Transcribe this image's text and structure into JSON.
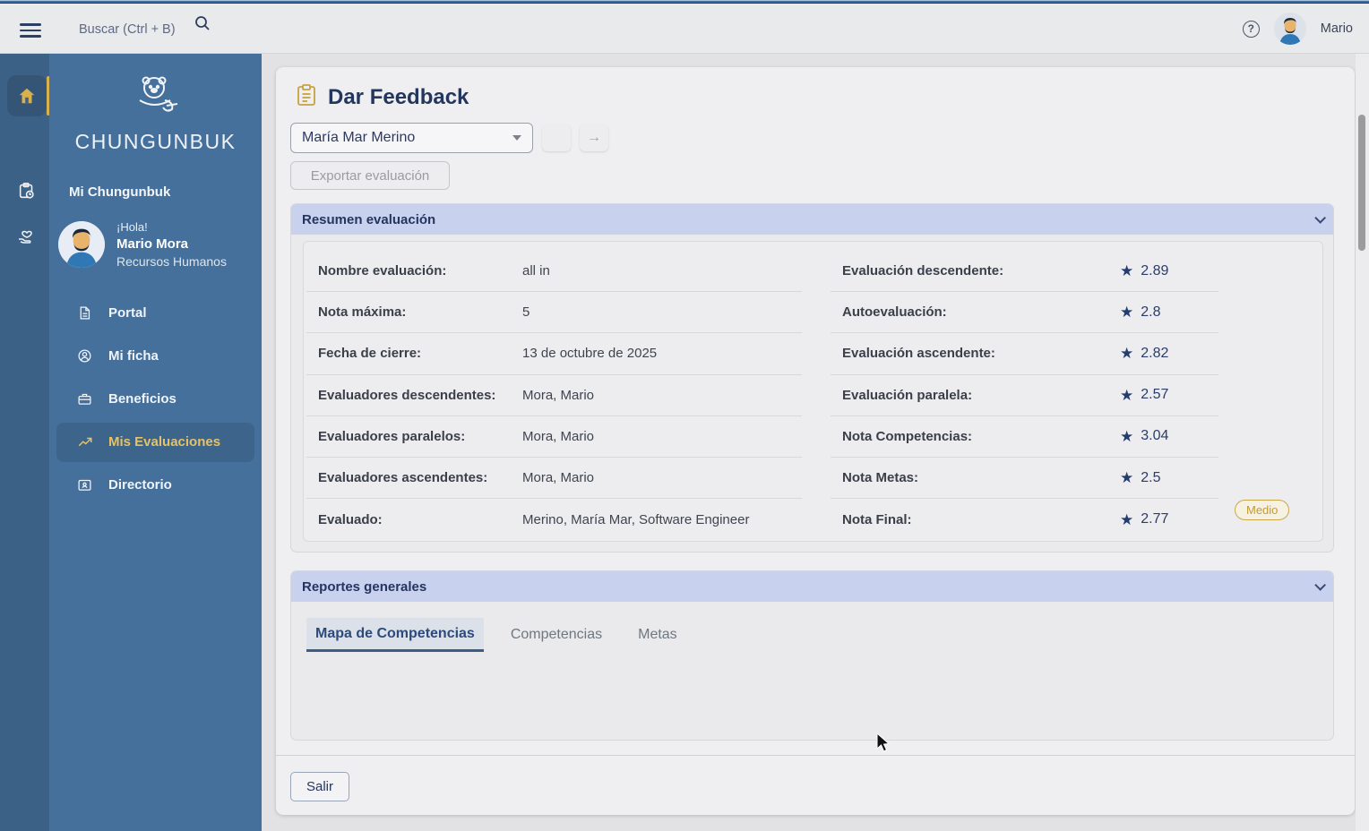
{
  "topbar": {
    "search_placeholder": "Buscar (Ctrl + B)",
    "user_name": "Mario"
  },
  "sidebar": {
    "logo_text": "CHUNGUNBUK",
    "section_label": "Mi Chungunbuk",
    "greeting": "¡Hola!",
    "user_name": "Mario Mora",
    "user_role": "Recursos Humanos",
    "items": [
      {
        "label": "Portal",
        "active": false
      },
      {
        "label": "Mi ficha",
        "active": false
      },
      {
        "label": "Beneficios",
        "active": false
      },
      {
        "label": "Mis Evaluaciones",
        "active": true
      },
      {
        "label": "Directorio",
        "active": false
      }
    ]
  },
  "main": {
    "title": "Dar Feedback",
    "person_select": {
      "value": "María Mar Merino"
    },
    "next_button_icon": "→",
    "export_button": "Exportar evaluación",
    "summary": {
      "title": "Resumen evaluación",
      "left_rows": [
        {
          "label": "Nombre evaluación:",
          "value": "all in"
        },
        {
          "label": "Nota máxima:",
          "value": "5"
        },
        {
          "label": "Fecha de cierre:",
          "value": "13 de octubre de 2025"
        },
        {
          "label": "Evaluadores descendentes:",
          "value": "Mora, Mario"
        },
        {
          "label": "Evaluadores paralelos:",
          "value": "Mora, Mario"
        },
        {
          "label": "Evaluadores ascendentes:",
          "value": "Mora, Mario"
        },
        {
          "label": "Evaluado:",
          "value": "Merino, María Mar, Software Engineer"
        }
      ],
      "right_rows": [
        {
          "label": "Evaluación descendente:",
          "value": "2.89"
        },
        {
          "label": "Autoevaluación:",
          "value": "2.8"
        },
        {
          "label": "Evaluación ascendente:",
          "value": "2.82"
        },
        {
          "label": "Evaluación paralela:",
          "value": "2.57"
        },
        {
          "label": "Nota Competencias:",
          "value": "3.04"
        },
        {
          "label": "Nota Metas:",
          "value": "2.5"
        },
        {
          "label": "Nota Final:",
          "value": "2.77"
        }
      ],
      "final_badge": "Medio"
    },
    "reports": {
      "title": "Reportes generales",
      "tabs": [
        {
          "label": "Mapa de Competencias",
          "active": true
        },
        {
          "label": "Competencias",
          "active": false
        },
        {
          "label": "Metas",
          "active": false
        }
      ]
    },
    "exit_button": "Salir"
  },
  "colors": {
    "sidebar_blue": "#44709b",
    "rail_blue": "#3c6186",
    "accent_gold": "#d8b04c",
    "panel_header_lavender": "#c8d2ef",
    "star_navy": "#253c6e",
    "badge_gold": "#c49a33"
  }
}
